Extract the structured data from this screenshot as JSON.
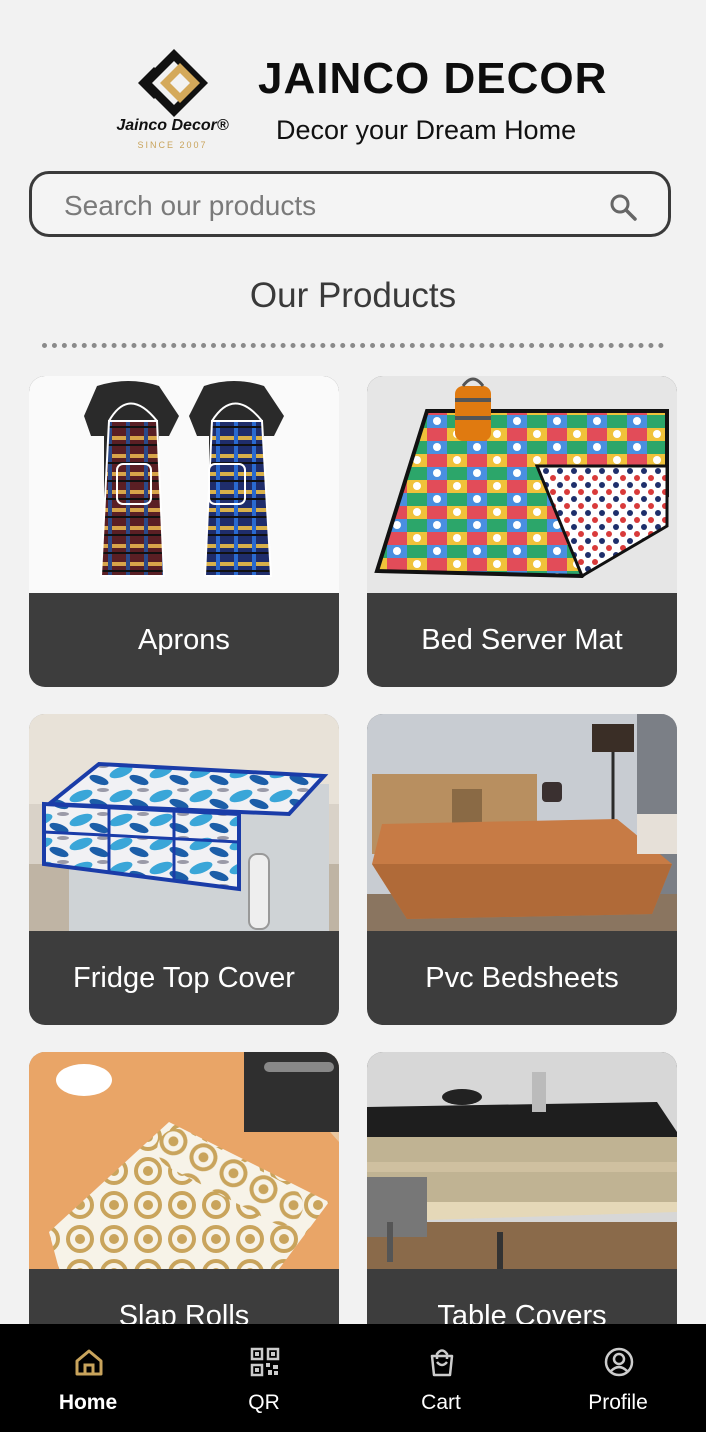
{
  "header": {
    "logo_name": "Jainco Decor®",
    "logo_since": "SINCE 2007",
    "brand": "JAINCO DECOR",
    "tagline": "Decor your Dream Home"
  },
  "search": {
    "placeholder": "Search our products",
    "value": ""
  },
  "section": {
    "title": "Our Products"
  },
  "products": [
    {
      "label": "Aprons"
    },
    {
      "label": "Bed Server Mat"
    },
    {
      "label": "Fridge Top Cover"
    },
    {
      "label": "Pvc Bedsheets"
    },
    {
      "label": "Slap Rolls"
    },
    {
      "label": "Table Covers"
    }
  ],
  "nav": {
    "items": [
      {
        "label": "Home",
        "icon": "home-icon",
        "active": true
      },
      {
        "label": "QR",
        "icon": "qr-code-icon",
        "active": false
      },
      {
        "label": "Cart",
        "icon": "shopping-bag-icon",
        "active": false
      },
      {
        "label": "Profile",
        "icon": "user-circle-icon",
        "active": false
      }
    ]
  },
  "colors": {
    "accent": "#c9a45c",
    "card_bg": "#3d3d3d",
    "nav_bg": "#000000",
    "page_bg": "#f2f2f2"
  }
}
